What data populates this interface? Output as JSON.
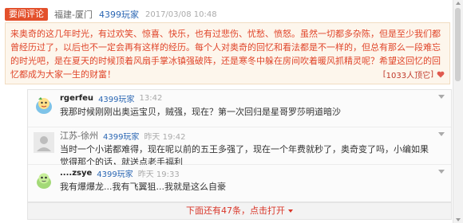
{
  "featured": {
    "badge": "要闻评论",
    "location": "福建-厦门",
    "platform": "4399玩家",
    "timestamp": "2017/03/08 10:48",
    "text": "来奥奇的这几年时光，有过欢笑、惊喜、快乐，也有过悲伤、忧愁、愤怒。虽然一切都多杂陈，但是至少我们都曾经历过了，以后也不一定会再有这样的经历。每个人对奥奇的回忆和看法都是不一样的，但总有那么一段难忘的时光吧，是在夏天的时候顶着风扇手掌冰镇强破阵，还是寒冬中躲在房间吹着暖风抓精灵呢？希望这回忆的回忆都成为大家一生的财富！",
    "likes": "1033人顶它",
    "heart_icon": "heart-icon"
  },
  "comments": [
    {
      "name": "rgerfeu",
      "location": "",
      "platform": "4399玩家",
      "time": "13:42",
      "text": "我那时候刚刚出奥运宝贝，贼强，现在？第一次回归是星哥罗莎明道暗沙",
      "avatar": "cartoon-avatar"
    },
    {
      "name": "",
      "location": "江苏-徐州",
      "platform": "4399玩家",
      "time": "昨天 19:42",
      "text": "当时一个小诺都难得，现在呢以前的五王多强了，现在一个年费就秒了，奥奇变了吗，小编如果觉得那个的话，就送点老手福利",
      "avatar": "default-avatar"
    },
    {
      "name": "....zsye",
      "location": "",
      "platform": "4399玩家",
      "time": "昨天 19:33",
      "text": "我有爆爆龙...我有飞翼狙...我就是这么自豪",
      "avatar": "cartoon-avatar"
    }
  ],
  "more": {
    "label": "下面还有47条，点击打开"
  },
  "colors": {
    "accent_red": "#e3502b",
    "link_blue": "#2a66b3",
    "featured_bg": "#fdf6ec"
  }
}
